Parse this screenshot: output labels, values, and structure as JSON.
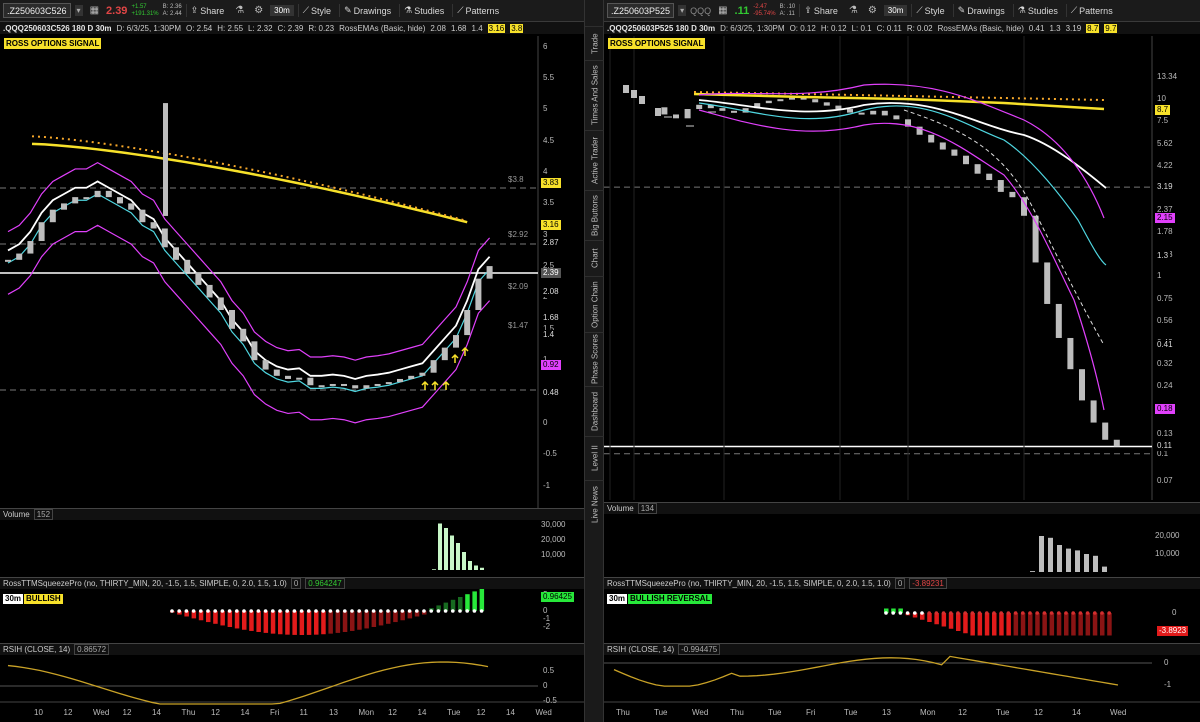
{
  "left": {
    "symbol": ".Z250603C526",
    "last": "2.39",
    "change_top": "+1.57",
    "change_pct": "+191.31%",
    "bid": "B: 2.36",
    "ask": "A: 2.44",
    "tb": {
      "share": "Share",
      "timeframe": "30m",
      "style": "Style",
      "drawings": "Drawings",
      "studies": "Studies",
      "patterns": "Patterns"
    },
    "info": {
      "title": ".QQQ250603C526 180 D 30m",
      "date": "D: 6/3/25, 1:30PM",
      "o": "O: 2.54",
      "h": "H: 2.55",
      "l": "L: 2.32",
      "c": "C: 2.39",
      "r": "R: 0.23",
      "study": "RossEMAs (Basic, hide)",
      "v1": "2.08",
      "v2": "1.68",
      "v3": "1.4",
      "v4": "3.16",
      "v5": "3.8"
    },
    "signal": "ROSS OPTIONS SIGNAL",
    "yticks": [
      "6",
      "5.5",
      "5",
      "4.5",
      "4",
      "3.5",
      "3",
      "2.5",
      "2",
      "1.5",
      "1",
      "0.5",
      "0",
      "-0.5",
      "-1"
    ],
    "tags": [
      {
        "t": "3.83",
        "bg": "#f7e12a",
        "fg": "#000"
      },
      {
        "t": "3.16",
        "bg": "#f7e12a",
        "fg": "#000"
      },
      {
        "t": "2.87",
        "bg": "#000",
        "fg": "#ddd"
      },
      {
        "t": "2.39",
        "bg": "#555",
        "fg": "#fff"
      },
      {
        "t": "2.08",
        "bg": "#000",
        "fg": "#ddd"
      },
      {
        "t": "1.68",
        "bg": "#000",
        "fg": "#ddd"
      },
      {
        "t": "1.4",
        "bg": "#000",
        "fg": "#ddd"
      },
      {
        "t": "0.92",
        "bg": "#e040fb",
        "fg": "#000"
      },
      {
        "t": "0.48",
        "bg": "#000",
        "fg": "#ddd"
      }
    ],
    "level_labels": [
      "$3.8",
      "$2.92",
      "$2.09",
      "$1.47"
    ],
    "volume": {
      "label": "Volume",
      "value": "152",
      "ticks": [
        "30,000",
        "20,000",
        "10,000"
      ]
    },
    "squeeze": {
      "label": "RossTTMSqueezePro (no, THIRTY_MIN, 20, -1.5, 1.5, SIMPLE, 0, 2.0, 1.5, 1.0)",
      "v0": "0",
      "value": "0.964247",
      "tf": "30m",
      "state": "BULLISH",
      "tag": "0.96425",
      "ticks": [
        "2",
        "0",
        "-1",
        "-2"
      ]
    },
    "rsi": {
      "label": "RSIH (CLOSE, 14)",
      "value": "0.86572",
      "ticks": [
        "0.5",
        "0",
        "-0.5"
      ]
    },
    "dates": [
      "10",
      "12",
      "Wed",
      "12",
      "14",
      "Thu",
      "12",
      "14",
      "Fri",
      "11",
      "13",
      "Mon",
      "12",
      "14",
      "Tue",
      "12",
      "14",
      "Wed"
    ]
  },
  "right": {
    "symbol": ".Z250603P525",
    "name": "QQQ",
    "last": ".11",
    "change_top": "-2.47",
    "change_pct": "-95.74%",
    "bid": "B: .10",
    "ask": "A: .11",
    "tb": {
      "share": "Share",
      "timeframe": "30m",
      "style": "Style",
      "drawings": "Drawings",
      "studies": "Studies",
      "patterns": "Patterns"
    },
    "info": {
      "title": ".QQQ250603P525 180 D 30m",
      "date": "D: 6/3/25, 1:30PM",
      "o": "O: 0.12",
      "h": "H: 0.12",
      "l": "L: 0.1",
      "c": "C: 0.11",
      "r": "R: 0.02",
      "study": "RossEMAs (Basic, hide)",
      "v1": "0.41",
      "v2": "1.3",
      "v3": "3.19",
      "v4": "8.7",
      "v5": "9.7"
    },
    "signal": "ROSS OPTIONS SIGNAL",
    "yticks": [
      "13.34",
      "10",
      "7.5",
      "5.62",
      "4.22",
      "3.16",
      "2.37",
      "1.78",
      "1.33",
      "1",
      "0.75",
      "0.56",
      "0.42",
      "0.32",
      "0.24",
      "0.18",
      "0.13",
      "0.1",
      "0.07"
    ],
    "tags": [
      {
        "t": "8.7",
        "bg": "#f7e12a",
        "fg": "#000"
      },
      {
        "t": "3.19",
        "bg": "#000",
        "fg": "#ddd"
      },
      {
        "t": "2.15",
        "bg": "#e040fb",
        "fg": "#000"
      },
      {
        "t": "1.3",
        "bg": "#000",
        "fg": "#ddd"
      },
      {
        "t": "0.41",
        "bg": "#000",
        "fg": "#ddd"
      },
      {
        "t": "0.18",
        "bg": "#e040fb",
        "fg": "#000"
      },
      {
        "t": "0.11",
        "bg": "#000",
        "fg": "#ddd"
      }
    ],
    "volume": {
      "label": "Volume",
      "value": "134",
      "ticks": [
        "20,000",
        "10,000"
      ]
    },
    "squeeze": {
      "label": "RossTTMSqueezePro (no, THIRTY_MIN, 20, -1.5, 1.5, SIMPLE, 0, 2.0, 1.5, 1.0)",
      "v0": "0",
      "value": "-3.89231",
      "tf": "30m",
      "state": "BULLISH REVERSAL",
      "tag": "-3.8923",
      "ticks": [
        "0"
      ]
    },
    "rsi": {
      "label": "RSIH (CLOSE, 14)",
      "value": "-0.994475",
      "ticks": [
        "0",
        "-1"
      ]
    },
    "dates": [
      "Thu",
      "Tue",
      "Wed",
      "Thu",
      "Tue",
      "Fri",
      "Tue",
      "13",
      "Mon",
      "12",
      "Tue",
      "12",
      "14",
      "Wed"
    ]
  },
  "sidebar": [
    "Trade",
    "Times And Sales",
    "Active Trader",
    "Big Buttons",
    "Chart",
    "Option Chain",
    "Phase Scores",
    "Dashboard",
    "Level II",
    "Live News"
  ],
  "colors": {
    "up_change": "#32c832",
    "down_change": "#e04545",
    "ema": "#f7e12a",
    "bull_hist": "#27e83a",
    "bear_hist": "#e21b1b",
    "rsi": "#c9a227",
    "band": "#e040fb",
    "cyan": "#4fd6e0"
  }
}
